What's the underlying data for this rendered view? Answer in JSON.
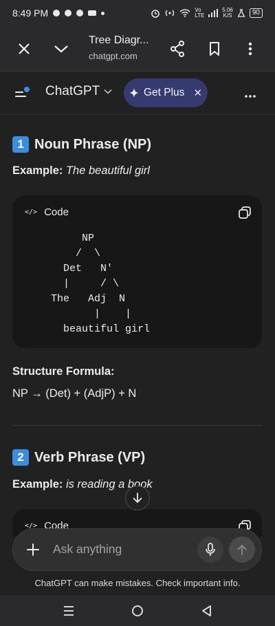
{
  "status_bar": {
    "time": "8:49 PM",
    "network_speed": "5.06",
    "network_speed_unit": "K/S",
    "battery": "90",
    "icons": [
      "chat-bubble-icon",
      "cloud-icon",
      "circle-app-icon",
      "app-icon",
      "dot-icon",
      "alarm-icon",
      "hotspot-icon",
      "wifi-icon",
      "volte-icon",
      "signal-icon",
      "lab-icon"
    ]
  },
  "browser": {
    "tab_title": "Tree Diagr...",
    "url": "chatgpt.com"
  },
  "app": {
    "title": "ChatGPT",
    "upgrade_label": "Get Plus",
    "accent": "#373a6f"
  },
  "sections": [
    {
      "number": "1",
      "heading": "Noun Phrase (NP)",
      "example_label": "Example:",
      "example_text": "The beautiful girl",
      "code_label": "Code",
      "code": "     NP\n    /  \\\n  Det   N'\n  |     / \\\nThe   Adj  N\n       |    |\n  beautiful girl",
      "formula_heading": "Structure Formula:",
      "formula": "NP → (Det) + (AdjP) + N"
    },
    {
      "number": "2",
      "heading": "Verb Phrase (VP)",
      "example_label": "Example:",
      "example_text": "is reading a book",
      "code_label": "Code"
    }
  ],
  "composer": {
    "placeholder": "Ask anything"
  },
  "disclaimer": "ChatGPT can make mistakes. Check important info."
}
